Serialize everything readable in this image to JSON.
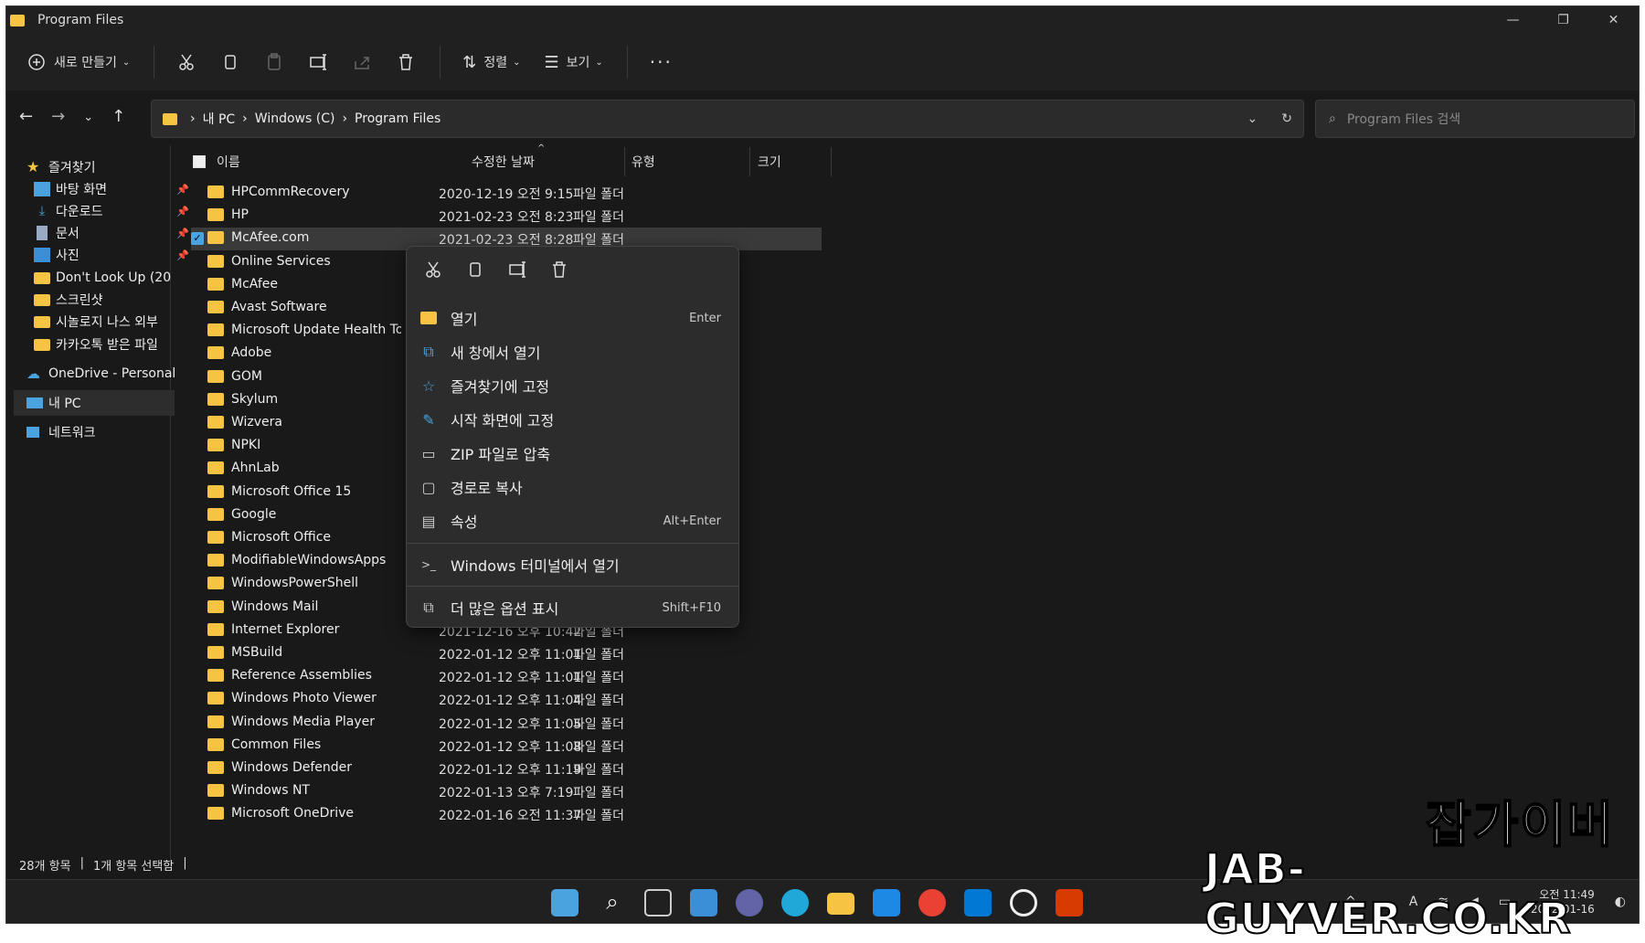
{
  "window": {
    "title": "Program Files"
  },
  "toolbar": {
    "new_label": "새로 만들기",
    "sort_label": "정렬",
    "view_label": "보기"
  },
  "address": {
    "crumbs": [
      "내 PC",
      "Windows (C)",
      "Program Files"
    ]
  },
  "search": {
    "placeholder": "Program Files 검색"
  },
  "sidebar": {
    "items": [
      {
        "label": "즐겨찾기"
      },
      {
        "label": "바탕 화면"
      },
      {
        "label": "다운로드"
      },
      {
        "label": "문서"
      },
      {
        "label": "사진"
      },
      {
        "label": "Don't Look Up (20"
      },
      {
        "label": "스크린샷"
      },
      {
        "label": "시놀로지 나스 외부"
      },
      {
        "label": "카카오톡 받은 파일"
      },
      {
        "label": "OneDrive - Personal"
      },
      {
        "label": "내 PC"
      },
      {
        "label": "네트워크"
      }
    ]
  },
  "columns": {
    "name": "이름",
    "date": "수정한 날짜",
    "type": "유형",
    "size": "크기"
  },
  "files": [
    {
      "name": "HPCommRecovery",
      "date": "2020-12-19 오전 9:15",
      "type": "파일 폴더"
    },
    {
      "name": "HP",
      "date": "2021-02-23 오전 8:23",
      "type": "파일 폴더"
    },
    {
      "name": "McAfee.com",
      "date": "2021-02-23 오전 8:28",
      "type": "파일 폴더"
    },
    {
      "name": "Online Services",
      "date": "",
      "type": ""
    },
    {
      "name": "McAfee",
      "date": "",
      "type": ""
    },
    {
      "name": "Avast Software",
      "date": "",
      "type": ""
    },
    {
      "name": "Microsoft Update Health Too",
      "date": "",
      "type": ""
    },
    {
      "name": "Adobe",
      "date": "",
      "type": ""
    },
    {
      "name": "GOM",
      "date": "",
      "type": ""
    },
    {
      "name": "Skylum",
      "date": "",
      "type": ""
    },
    {
      "name": "Wizvera",
      "date": "",
      "type": ""
    },
    {
      "name": "NPKI",
      "date": "",
      "type": ""
    },
    {
      "name": "AhnLab",
      "date": "",
      "type": ""
    },
    {
      "name": "Microsoft Office 15",
      "date": "",
      "type": ""
    },
    {
      "name": "Google",
      "date": "",
      "type": ""
    },
    {
      "name": "Microsoft Office",
      "date": "",
      "type": ""
    },
    {
      "name": "ModifiableWindowsApps",
      "date": "",
      "type": ""
    },
    {
      "name": "WindowsPowerShell",
      "date": "",
      "type": ""
    },
    {
      "name": "Windows Mail",
      "date": "",
      "type": ""
    },
    {
      "name": "Internet Explorer",
      "date": "2021-12-16 오후 10:42",
      "type": "파일 폴더"
    },
    {
      "name": "MSBuild",
      "date": "2022-01-12 오후 11:01",
      "type": "파일 폴더"
    },
    {
      "name": "Reference Assemblies",
      "date": "2022-01-12 오후 11:01",
      "type": "파일 폴더"
    },
    {
      "name": "Windows Photo Viewer",
      "date": "2022-01-12 오후 11:04",
      "type": "파일 폴더"
    },
    {
      "name": "Windows Media Player",
      "date": "2022-01-12 오후 11:05",
      "type": "파일 폴더"
    },
    {
      "name": "Common Files",
      "date": "2022-01-12 오후 11:08",
      "type": "파일 폴더"
    },
    {
      "name": "Windows Defender",
      "date": "2022-01-12 오후 11:19",
      "type": "파일 폴더"
    },
    {
      "name": "Windows NT",
      "date": "2022-01-13 오후 7:19",
      "type": "파일 폴더"
    },
    {
      "name": "Microsoft OneDrive",
      "date": "2022-01-16 오전 11:37",
      "type": "파일 폴더"
    }
  ],
  "context_menu": {
    "items": [
      {
        "label": "열기",
        "shortcut": "Enter"
      },
      {
        "label": "새 창에서 열기",
        "shortcut": ""
      },
      {
        "label": "즐겨찾기에 고정",
        "shortcut": ""
      },
      {
        "label": "시작 화면에 고정",
        "shortcut": ""
      },
      {
        "label": "ZIP 파일로 압축",
        "shortcut": ""
      },
      {
        "label": "경로로 복사",
        "shortcut": ""
      },
      {
        "label": "속성",
        "shortcut": "Alt+Enter"
      },
      {
        "label": "Windows 터미널에서 열기",
        "shortcut": ""
      },
      {
        "label": "더 많은 옵션 표시",
        "shortcut": "Shift+F10"
      }
    ]
  },
  "status": {
    "count": "28개 항목",
    "selected": "1개 항목 선택함"
  },
  "clock": {
    "time": "오전 11:49",
    "date": "2022-01-16"
  },
  "watermark": {
    "line1": "잡가이버",
    "line2": "JAB-GUYVER.CO.KR"
  },
  "colors": {
    "folder": "#f6c343",
    "accent": "#4aa3df",
    "background": "#191919"
  }
}
